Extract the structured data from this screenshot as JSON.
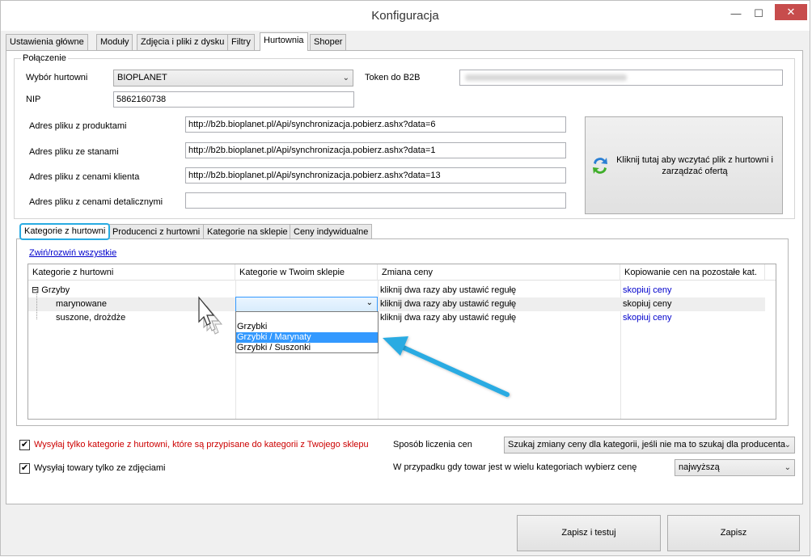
{
  "window": {
    "title": "Konfiguracja",
    "minimize_glyph": "—",
    "maximize_glyph": "☐",
    "close_glyph": "✕"
  },
  "main_tabs": [
    {
      "label": "Ustawienia główne"
    },
    {
      "label": "Moduły"
    },
    {
      "label": "Zdjęcia i pliki z dysku"
    },
    {
      "label": "Filtry"
    },
    {
      "label": "Hurtownia",
      "active": true
    },
    {
      "label": "Shoper"
    }
  ],
  "connection": {
    "legend": "Połączenie",
    "wholesaler_label": "Wybór hurtowni",
    "wholesaler_value": "BIOPLANET",
    "token_label": "Token do B2B",
    "nip_label": "NIP",
    "nip_value": "5862160738",
    "products_url_label": "Adres pliku z produktami",
    "products_url_value": "http://b2b.bioplanet.pl/Api/synchronizacja.pobierz.ashx?data=6",
    "stock_url_label": "Adres pliku ze stanami",
    "stock_url_value": "http://b2b.bioplanet.pl/Api/synchronizacja.pobierz.ashx?data=1",
    "client_prices_url_label": "Adres pliku z cenami klienta",
    "client_prices_url_value": "http://b2b.bioplanet.pl/Api/synchronizacja.pobierz.ashx?data=13",
    "retail_prices_url_label": "Adres pliku z cenami detalicznymi",
    "retail_prices_url_value": "",
    "load_button_label": "Kliknij tutaj aby wczytać plik z hurtowni i zarządzać ofertą"
  },
  "sub_tabs": [
    {
      "label": "Kategorie z hurtowni",
      "active": true
    },
    {
      "label": "Producenci z hurtowni"
    },
    {
      "label": "Kategorie na sklepie"
    },
    {
      "label": "Ceny indywidualne"
    }
  ],
  "categories": {
    "toggle_all_link": "Zwiń/rozwiń wszystkie",
    "columns": [
      "Kategorie z hurtowni",
      "Kategorie w Twoim sklepie",
      "Zmiana ceny",
      "Kopiowanie cen na pozostałe kat."
    ],
    "rows": [
      {
        "name": "Grzyby",
        "expander": "⊟",
        "shop_category": "",
        "price_change": "kliknij dwa razy aby ustawić regułę",
        "copy": "skopiuj ceny"
      },
      {
        "name": "marynowane",
        "shop_category": "",
        "price_change": "kliknij dwa razy aby ustawić regułę",
        "copy": "skopiuj ceny"
      },
      {
        "name": "suszone, drożdże",
        "shop_category": "",
        "price_change": "kliknij dwa razy aby ustawić regułę",
        "copy": "skopiuj ceny"
      }
    ],
    "dropdown_options": [
      "Grzybki",
      "Grzybki / Marynaty",
      "Grzybki / Suszonki"
    ],
    "dropdown_selected_index": 1
  },
  "options": {
    "only_assigned_checked": true,
    "only_assigned_label": "Wysyłaj tylko kategorie z hurtowni, które są przypisane do kategorii z Twojego sklepu",
    "only_with_photos_checked": true,
    "only_with_photos_label": "Wysyłaj towary tylko ze zdjęciami",
    "check_glyph": "✔",
    "price_method_label": "Sposób liczenia cen",
    "price_method_value": "Szukaj zmiany ceny dla kategorii, jeśli nie ma to szukaj dla producenta",
    "multi_category_label": "W przypadku gdy towar jest w wielu kategoriach wybierz cenę",
    "multi_category_value": "najwyższą"
  },
  "footer": {
    "save_test_label": "Zapisz i testuj",
    "save_label": "Zapisz"
  },
  "colors": {
    "accent_highlight": "#29abe2",
    "red_text": "#cc0000",
    "selection": "#3399ff"
  }
}
